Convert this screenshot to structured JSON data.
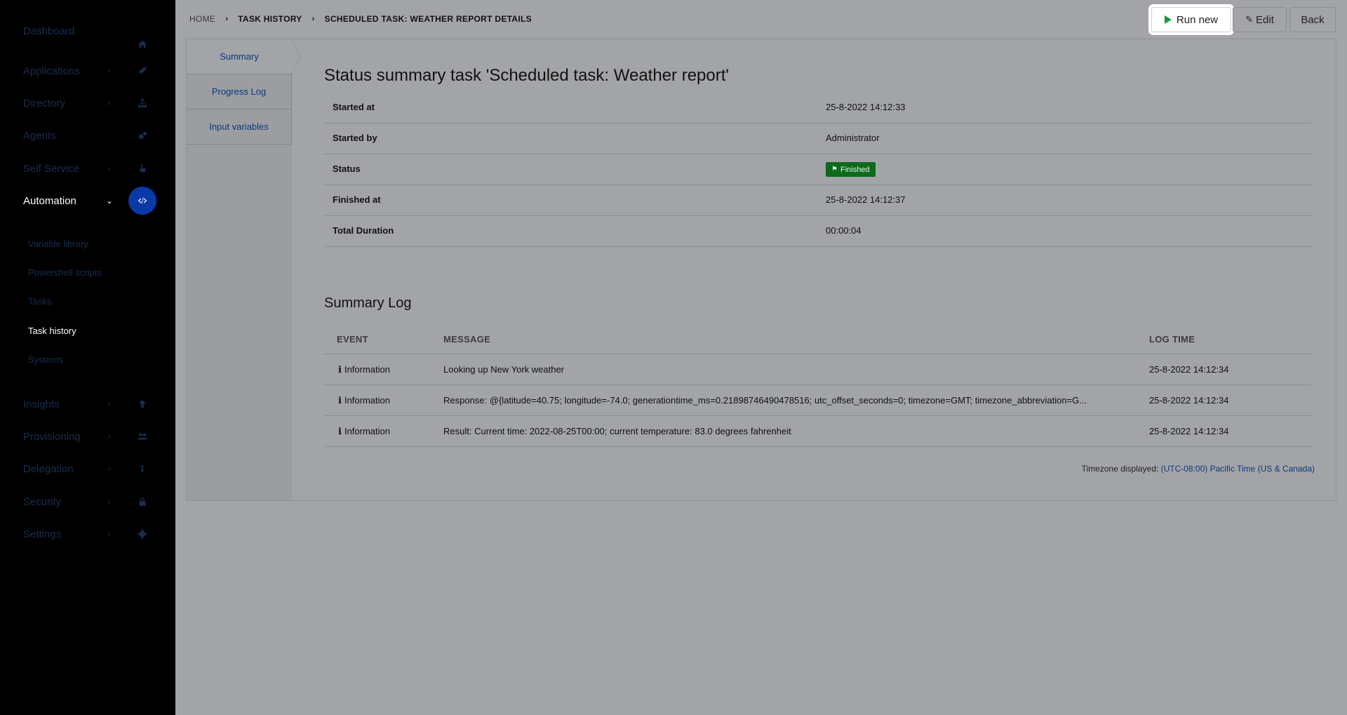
{
  "sidebar": {
    "items": [
      {
        "label": "Dashboard",
        "icon": "home-icon",
        "chevron": false,
        "active": false
      },
      {
        "label": "Applications",
        "icon": "rocket-icon",
        "chevron": true,
        "active": false
      },
      {
        "label": "Directory",
        "icon": "sitemap-icon",
        "chevron": true,
        "active": false
      },
      {
        "label": "Agents",
        "icon": "cogs-icon",
        "chevron": false,
        "active": false
      },
      {
        "label": "Self Service",
        "icon": "hand-pointer-icon",
        "chevron": true,
        "active": false
      },
      {
        "label": "Automation",
        "icon": "code-icon",
        "chevron": true,
        "active": true
      },
      {
        "label": "Insights",
        "icon": "lightbulb-icon",
        "chevron": true,
        "active": false
      },
      {
        "label": "Provisioning",
        "icon": "users-icon",
        "chevron": true,
        "active": false
      },
      {
        "label": "Delegation",
        "icon": "level-down-icon",
        "chevron": true,
        "active": false
      },
      {
        "label": "Security",
        "icon": "lock-icon",
        "chevron": true,
        "active": false
      },
      {
        "label": "Settings",
        "icon": "gear-icon",
        "chevron": true,
        "active": false
      }
    ],
    "automation_sub": [
      {
        "label": "Variable library",
        "active": false
      },
      {
        "label": "Powershell scripts",
        "active": false
      },
      {
        "label": "Tasks",
        "active": false
      },
      {
        "label": "Task history",
        "active": true
      },
      {
        "label": "Systems",
        "active": false
      }
    ]
  },
  "breadcrumb": {
    "home": "HOME",
    "task_history": "TASK HISTORY",
    "current": "SCHEDULED TASK: WEATHER REPORT DETAILS"
  },
  "toolbar": {
    "run_new": "Run new",
    "edit": "Edit",
    "back": "Back"
  },
  "tabs": [
    "Summary",
    "Progress Log",
    "Input variables"
  ],
  "summary": {
    "title": "Status summary task 'Scheduled task: Weather report'",
    "rows": [
      {
        "key": "Started at",
        "value": "25-8-2022 14:12:33"
      },
      {
        "key": "Started by",
        "value": "Administrator"
      },
      {
        "key": "Status",
        "value": "Finished"
      },
      {
        "key": "Finished at",
        "value": "25-8-2022 14:12:37"
      },
      {
        "key": "Total Duration",
        "value": "00:00:04"
      }
    ],
    "status_color": "#0b6b1c"
  },
  "log": {
    "title": "Summary Log",
    "headers": {
      "event": "EVENT",
      "message": "MESSAGE",
      "time": "LOG TIME"
    },
    "rows": [
      {
        "event": "Information",
        "message": "Looking up New York weather",
        "time": "25-8-2022 14:12:34"
      },
      {
        "event": "Information",
        "message": "Response: @{latitude=40.75; longitude=-74.0; generationtime_ms=0.21898746490478516; utc_offset_seconds=0; timezone=GMT; timezone_abbreviation=G...",
        "time": "25-8-2022 14:12:34"
      },
      {
        "event": "Information",
        "message": "Result: Current time: 2022-08-25T00:00; current temperature: 83.0 degrees fahrenheit",
        "time": "25-8-2022 14:12:34"
      }
    ]
  },
  "timezone": {
    "label": "Timezone displayed:",
    "value": "(UTC-08:00) Pacific Time (US & Canada)"
  }
}
